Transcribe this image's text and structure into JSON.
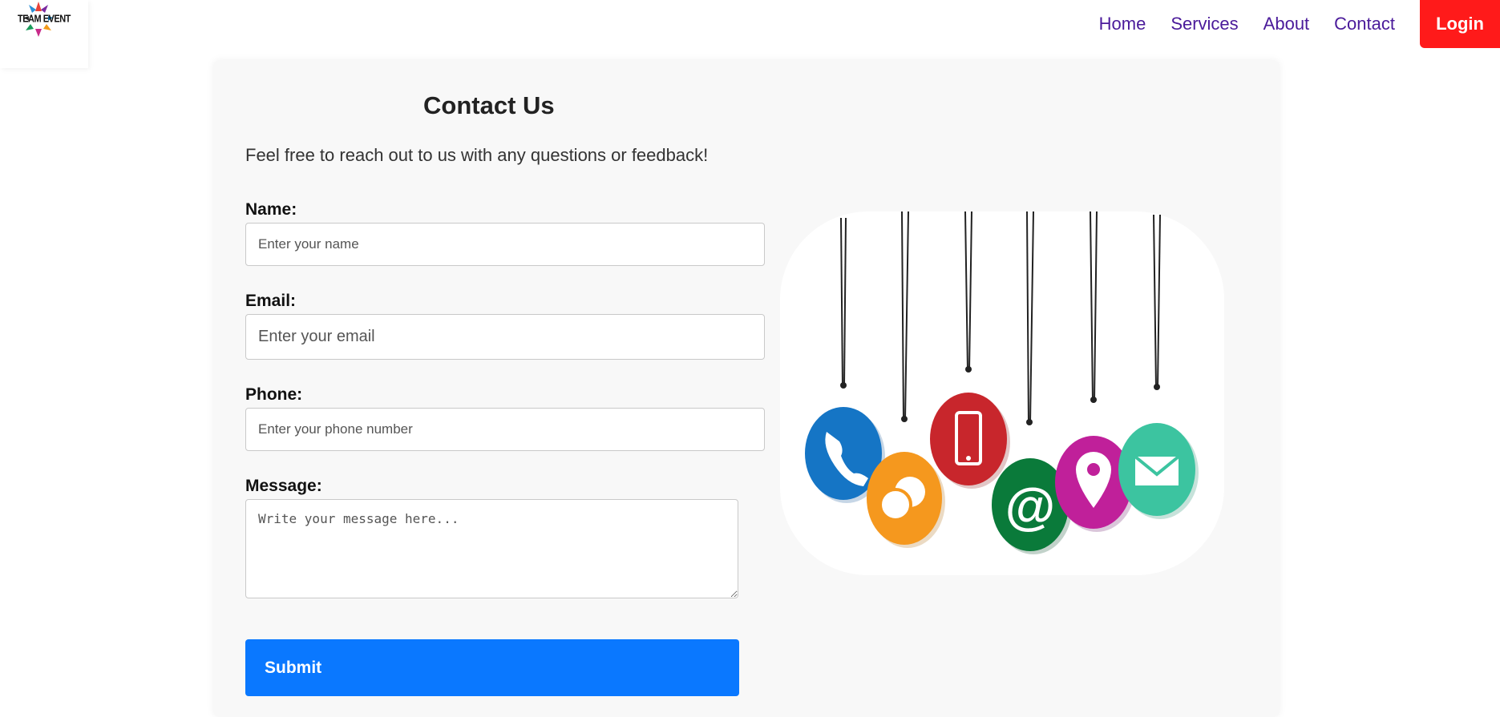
{
  "header": {
    "logo_text": "TEAM EVENT",
    "nav": [
      "Home",
      "Services",
      "About",
      "Contact"
    ],
    "login_label": "Login"
  },
  "contact": {
    "title": "Contact Us",
    "subtitle": "Feel free to reach out to us with any questions or feedback!",
    "name_label": "Name:",
    "name_placeholder": "Enter your name",
    "email_label": "Email:",
    "email_placeholder": "Enter your email",
    "phone_label": "Phone:",
    "phone_placeholder": "Enter your phone number",
    "message_label": "Message:",
    "message_placeholder": "Write your message here...",
    "submit_label": "Submit"
  },
  "illustration": {
    "tags": [
      "phone-icon",
      "chat-icon",
      "mobile-icon",
      "at-icon",
      "location-pin-icon",
      "mail-icon"
    ]
  },
  "colors": {
    "nav_link": "#4a1a9a",
    "login_bg": "#ff1a1a",
    "submit_bg": "#0a78ff"
  }
}
